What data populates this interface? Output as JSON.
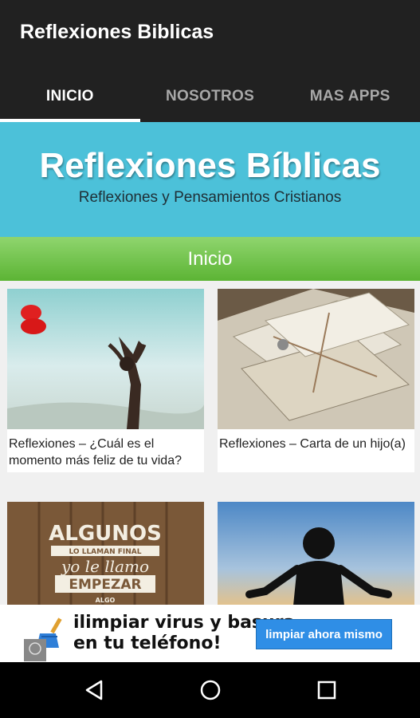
{
  "app": {
    "title": "Reflexiones Biblicas"
  },
  "tabs": [
    {
      "label": "INICIO",
      "active": true
    },
    {
      "label": "NOSOTROS",
      "active": false
    },
    {
      "label": "MAS APPS",
      "active": false
    }
  ],
  "banner": {
    "title": "Reflexiones Bíblicas",
    "subtitle": "Reflexiones y Pensamientos Cristianos"
  },
  "section": {
    "label": "Inicio"
  },
  "posts": [
    {
      "title": "Reflexiones – ¿Cuál es el momento más feliz de tu vida?"
    },
    {
      "title": "Reflexiones – Carta de un hijo(a)"
    },
    {
      "title": ""
    },
    {
      "title": ""
    }
  ],
  "thumb_text": {
    "line1": "ALGUNOS",
    "line2": "LO LLAMAN FINAL",
    "line3": "yo le llamo",
    "line4": "EMPEZAR",
    "line5": "ALGO"
  },
  "ad": {
    "text_line1": "ilimpiar virus y basura",
    "text_line2": "en tu teléfono!",
    "button_label": "limpiar ahora mismo"
  },
  "colors": {
    "appbar": "#212121",
    "banner": "#4cc1d9",
    "section_bar": "#6cc244",
    "ad_button": "#2f8ee6"
  }
}
